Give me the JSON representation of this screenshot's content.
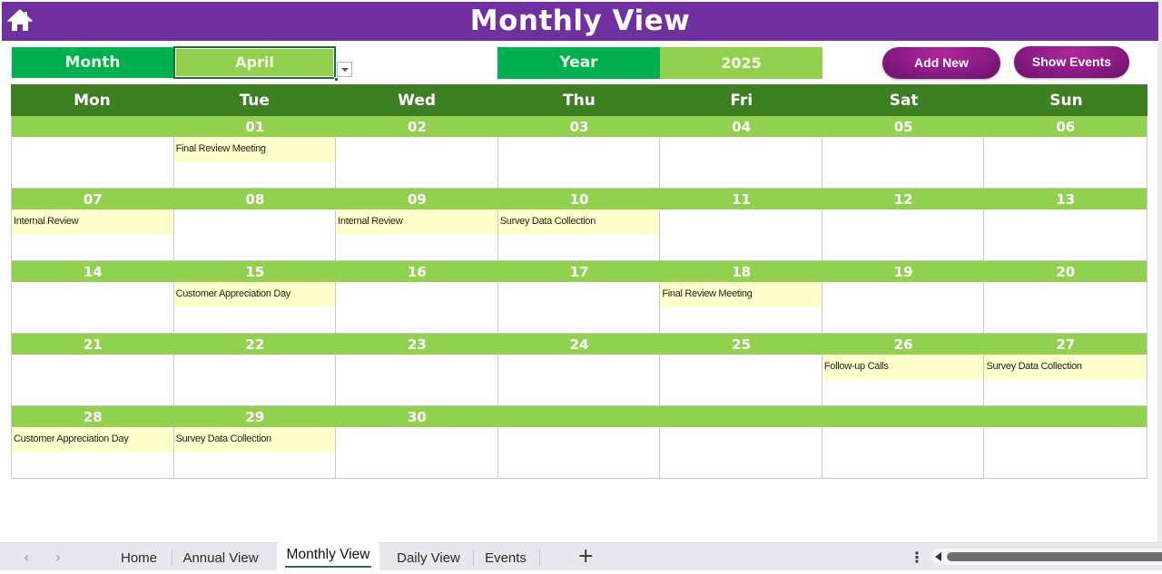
{
  "header": {
    "title": "Monthly View",
    "home_icon": "home-icon"
  },
  "filters": {
    "month_label": "Month",
    "month_value": "April",
    "year_label": "Year",
    "year_value": "2025"
  },
  "buttons": {
    "add_new": "Add New",
    "show_events": "Show Events"
  },
  "colors": {
    "title_bar": "#7030a0",
    "label_green": "#00b050",
    "light_green": "#92d050",
    "dark_green": "#3e7f23",
    "event_fill": "#ffffcc",
    "button_purple": "#8a1a86"
  },
  "calendar": {
    "days_of_week": [
      "Mon",
      "Tue",
      "Wed",
      "Thu",
      "Fri",
      "Sat",
      "Sun"
    ],
    "weeks": [
      {
        "dates": [
          "",
          "01",
          "02",
          "03",
          "04",
          "05",
          "06"
        ],
        "events": [
          "",
          "Final Review Meeting",
          "",
          "",
          "",
          "",
          ""
        ]
      },
      {
        "dates": [
          "07",
          "08",
          "09",
          "10",
          "11",
          "12",
          "13"
        ],
        "events": [
          "Internal Review",
          "",
          "Internal Review",
          "Survey Data Collection",
          "",
          "",
          ""
        ]
      },
      {
        "dates": [
          "14",
          "15",
          "16",
          "17",
          "18",
          "19",
          "20"
        ],
        "events": [
          "",
          "Customer Appreciation Day",
          "",
          "",
          "Final Review Meeting",
          "",
          ""
        ]
      },
      {
        "dates": [
          "21",
          "22",
          "23",
          "24",
          "25",
          "26",
          "27"
        ],
        "events": [
          "",
          "",
          "",
          "",
          "",
          "Follow-up Calls",
          "Survey Data Collection"
        ]
      },
      {
        "dates": [
          "28",
          "29",
          "30",
          "",
          "",
          "",
          ""
        ],
        "events": [
          "Customer Appreciation Day",
          "Survey Data Collection",
          "",
          "",
          "",
          "",
          ""
        ]
      }
    ]
  },
  "sheet_tabs": {
    "items": [
      "Home",
      "Annual View",
      "Monthly View",
      "Daily View",
      "Events"
    ],
    "active": "Monthly View",
    "add_label": "+",
    "prev_label": "‹",
    "next_label": "›",
    "more_label": "⋮"
  }
}
